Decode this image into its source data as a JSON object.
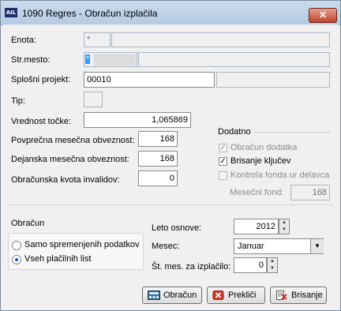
{
  "window": {
    "icon_text": "AIL",
    "title": "1090  Regres - Obračun izplačila",
    "close_glyph": "✕"
  },
  "fields": {
    "enota": {
      "label": "Enota:",
      "value": "*"
    },
    "str_mesto": {
      "label": "Str.mesto:",
      "value": "*"
    },
    "splosni_projekt": {
      "label": "Splošni projekt:",
      "value": "00010"
    },
    "tip": {
      "label": "Tip:"
    },
    "vrednost_tocke": {
      "label": "Vrednost točke:",
      "value": "1,065869"
    },
    "povprecna": {
      "label": "Povprečna mesečna obveznost:",
      "value": "168"
    },
    "dejanska": {
      "label": "Dejanska mesečna obveznost:",
      "value": "168"
    },
    "kvota": {
      "label": "Obračunska kvota invalidov:",
      "value": "0"
    }
  },
  "dodatno": {
    "title": "Dodatno",
    "options": [
      {
        "label": "Obračun dodatka",
        "checked": true,
        "enabled": false
      },
      {
        "label": "Brisanje ključev",
        "checked": true,
        "enabled": true
      },
      {
        "label": "Kontrola fonda ur delavca",
        "checked": false,
        "enabled": false
      }
    ],
    "mesecni_fond": {
      "label": "Mesečni fond:",
      "value": "168"
    }
  },
  "obracun": {
    "title": "Obračun",
    "options": [
      {
        "label": "Samo spremenjenih podatkov",
        "selected": false
      },
      {
        "label": "Vseh plačilnih list",
        "selected": true
      }
    ]
  },
  "period": {
    "leto": {
      "label": "Leto osnove:",
      "value": "2012"
    },
    "mesec": {
      "label": "Mesec:",
      "value": "Januar"
    },
    "st_mes": {
      "label": "Št. mes. za izplačilo:",
      "value": "0"
    }
  },
  "buttons": {
    "obracun": "Obračun",
    "preklici": "Prekliči",
    "brisanje": "Brisanje"
  },
  "icons": {
    "app": "app-logo-icon",
    "close": "close-icon",
    "calc": "calculator-icon",
    "cancel": "cancel-x-icon",
    "delete": "delete-doc-icon"
  }
}
